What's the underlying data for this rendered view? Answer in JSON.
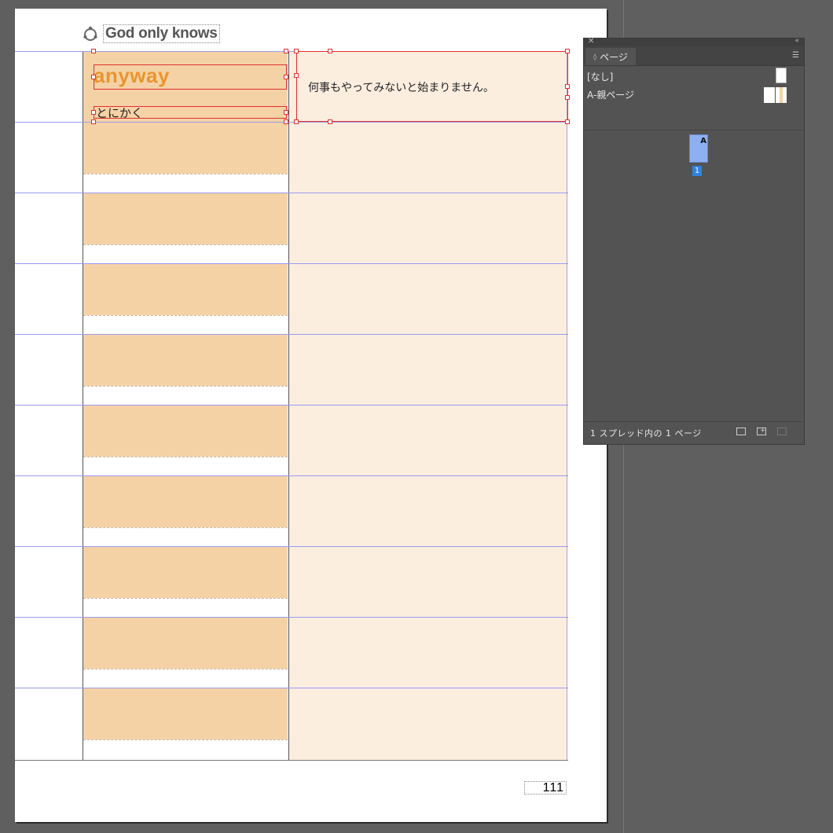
{
  "document": {
    "header_title": "God only knows",
    "logo_icon": "sync-circle-icon",
    "heading_text": "anyway",
    "subheading_text": "とにかく",
    "body_text": "何事もやってみないと始まりません。",
    "page_number": "111",
    "colors": {
      "left_cell": "#f5d2a6",
      "right_cell": "#fbeedf",
      "accent_text": "#e8952e",
      "selection": "#e03030",
      "guide": "#9a9af0"
    }
  },
  "pages_panel": {
    "tab_label": "ページ",
    "masters": [
      {
        "label": "[なし]"
      },
      {
        "label": "A-親ページ"
      }
    ],
    "page_thumb_master": "A",
    "page_label": "1",
    "footer_text": "1 スプレッド内の 1 ページ"
  }
}
